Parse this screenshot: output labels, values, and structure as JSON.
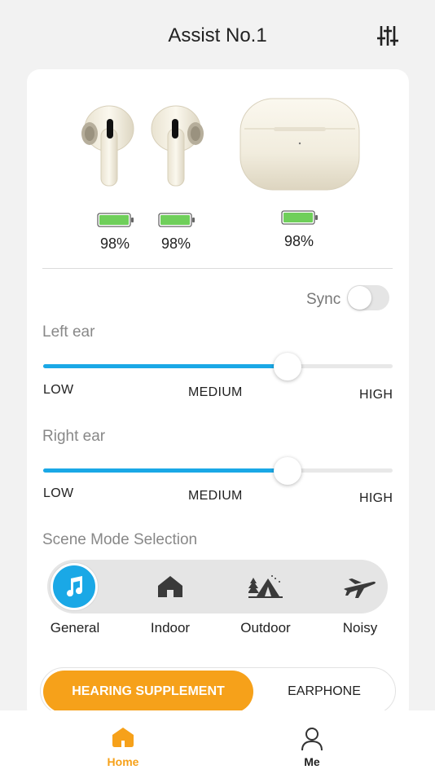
{
  "header": {
    "title": "Assist No.1",
    "settings_icon": "sliders-icon"
  },
  "devices": {
    "left_bud": {
      "battery": "98%"
    },
    "right_bud": {
      "battery": "98%"
    },
    "case": {
      "battery": "98%"
    },
    "battery_color": "#6fcf5a"
  },
  "sync": {
    "label": "Sync",
    "on": false
  },
  "left_ear": {
    "label": "Left ear",
    "value": 0.7,
    "low": "LOW",
    "medium": "MEDIUM",
    "high": "HIGH"
  },
  "right_ear": {
    "label": "Right ear",
    "value": 0.7,
    "low": "LOW",
    "medium": "MEDIUM",
    "high": "HIGH"
  },
  "scene": {
    "label": "Scene Mode Selection",
    "selected": "General",
    "modes": [
      {
        "name": "General",
        "icon": "music-note-icon"
      },
      {
        "name": "Indoor",
        "icon": "home-icon"
      },
      {
        "name": "Outdoor",
        "icon": "tent-icon"
      },
      {
        "name": "Noisy",
        "icon": "airplane-icon"
      }
    ]
  },
  "mode_toggle": {
    "active": "HEARING SUPPLEMENT",
    "inactive": "EARPHONE"
  },
  "tabbar": {
    "items": [
      {
        "label": "Home",
        "icon": "home-icon",
        "active": true
      },
      {
        "label": "Me",
        "icon": "person-icon",
        "active": false
      }
    ],
    "active_color": "#f6a11a"
  },
  "colors": {
    "accent": "#1aa8e6",
    "orange": "#f6a11a"
  }
}
